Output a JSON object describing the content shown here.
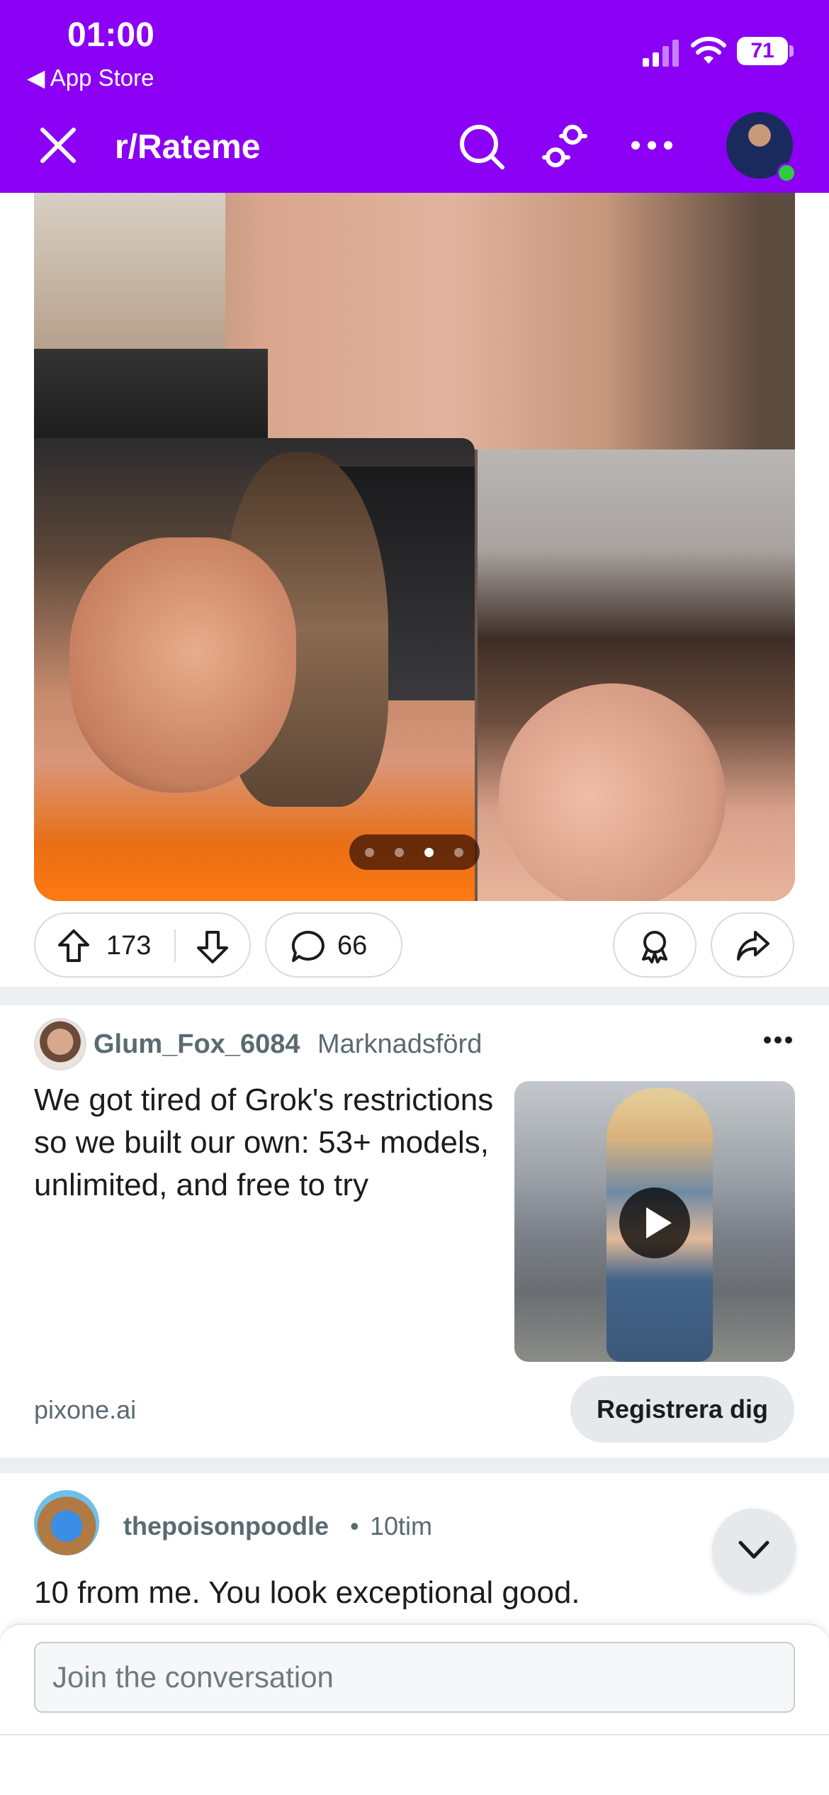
{
  "status_bar": {
    "time": "01:00",
    "back_label": "◀ App Store",
    "battery": "71"
  },
  "header": {
    "title": "r/Rateme",
    "avatar": "user-avatar"
  },
  "post": {
    "carousel_pages": 4,
    "carousel_active": 3,
    "upvotes": "173",
    "comments": "66"
  },
  "ad": {
    "username": "Glum_Fox_6084",
    "promoted_label": "Marknadsförd",
    "text": "We got tired of Grok's restrictions so we built our own: 53+ models, unlimited, and free to try",
    "domain": "pixone.ai",
    "cta": "Registrera dig"
  },
  "comment": {
    "username": "thepoisonpoodle",
    "separator": "•",
    "time": "10tim",
    "text": "10 from me. You look exceptional good."
  },
  "composer": {
    "placeholder": "Join the conversation"
  },
  "colors": {
    "header_bg": "#8b00f5",
    "online_dot": "#2ecc40",
    "pill_border": "#d8dadc",
    "muted_text": "#5a6a72"
  },
  "icons": [
    "close-icon",
    "search-icon",
    "filter-icon",
    "more-icon",
    "upvote-icon",
    "downvote-icon",
    "comment-icon",
    "award-icon",
    "share-icon",
    "play-icon",
    "chevron-down-icon",
    "signal-icon",
    "wifi-icon",
    "battery-icon"
  ]
}
